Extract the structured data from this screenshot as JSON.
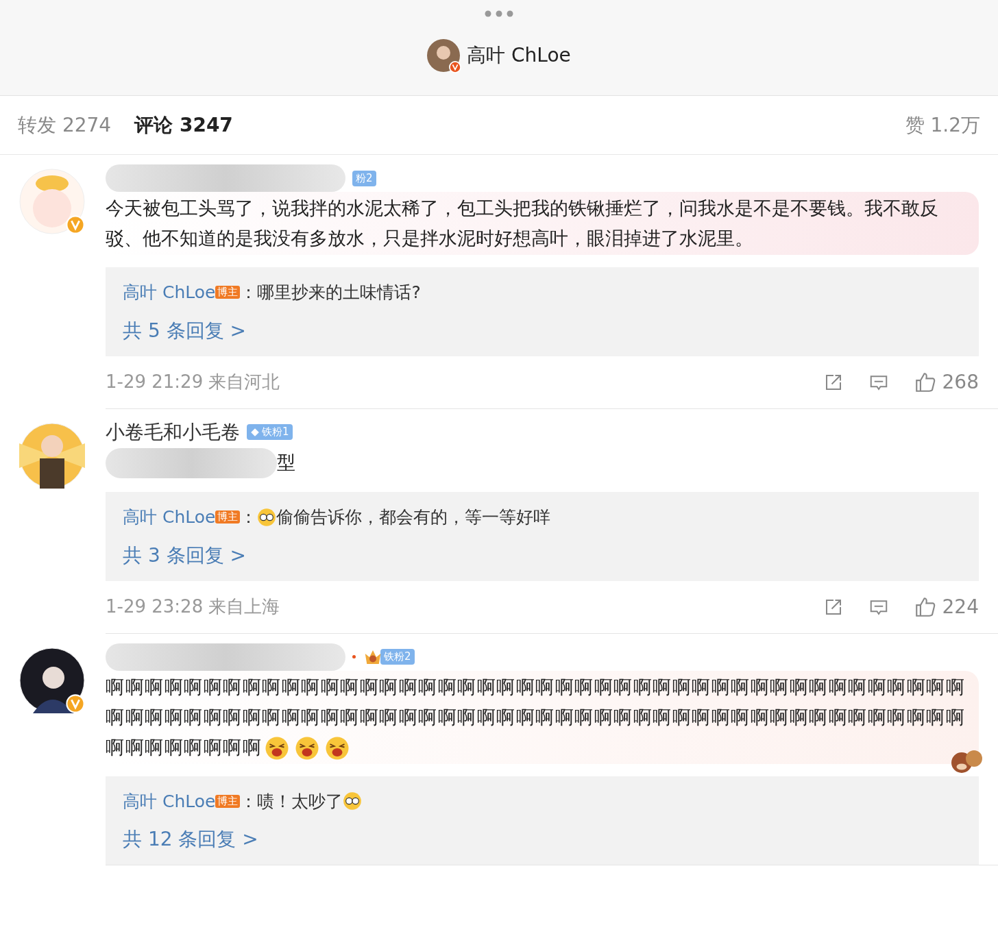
{
  "header": {
    "title": "高叶 ChLoe"
  },
  "tabs": [
    {
      "label": "转发",
      "count": "2274",
      "selected": false
    },
    {
      "label": "评论",
      "count": "3247",
      "selected": true
    }
  ],
  "likes_total": {
    "label": "赞",
    "count": "1.2万"
  },
  "comments": [
    {
      "verified": true,
      "badge": {
        "kind": "fan",
        "text": "粉2"
      },
      "color": "#fbe7ea",
      "sticker": false,
      "body": [
        {
          "kind": "text",
          "text": "今天被包工头骂了，说我拌的水泥太稀了，包工头把我的铁锹捶烂了，问我水是不是不要钱。我不敢反驳、他不知道的是我没有多放水，只是拌水泥时好想高叶，眼泪掉进了水泥里。"
        }
      ],
      "reply": {
        "author": "高叶 ChLoe",
        "badge": "博主",
        "parts": [
          {
            "kind": "text",
            "text": "：哪里抄来的土味情话?"
          }
        ],
        "more": "共 5 条回复 >"
      },
      "time": "1-29 21:29 来自河北",
      "likes": "268"
    },
    {
      "verified": false,
      "name": "小卷毛和小毛卷",
      "badge": {
        "kind": "diamond",
        "text": "铁粉1"
      },
      "sticker": false,
      "body": [
        {
          "kind": "blur"
        },
        {
          "kind": "text",
          "text": "型"
        }
      ],
      "reply": {
        "author": "高叶 ChLoe",
        "badge": "博主",
        "parts": [
          {
            "kind": "text",
            "text": "："
          },
          {
            "kind": "emoji"
          },
          {
            "kind": "text",
            "text": "偷偷告诉你，都会有的，等一等好咩"
          }
        ],
        "more": "共 3 条回复 >"
      },
      "time": "1-29 23:28 来自上海",
      "likes": "224"
    },
    {
      "verified": true,
      "badge": {
        "kind": "crown",
        "text": "铁粉2"
      },
      "color": "#fdf1ee",
      "sticker": true,
      "body": [
        {
          "kind": "text",
          "text": "啊啊啊啊啊啊啊啊啊啊啊啊啊啊啊啊啊啊啊啊啊啊啊啊啊啊啊啊啊啊啊啊啊啊啊啊啊啊啊啊啊啊啊啊啊啊啊啊啊啊啊啊啊啊啊啊啊啊啊啊啊啊啊啊啊啊啊啊啊啊啊啊啊啊啊啊啊啊啊啊啊啊啊啊啊啊啊啊啊啊啊啊啊啊啊啊"
        },
        {
          "kind": "laugh"
        },
        {
          "kind": "laugh"
        },
        {
          "kind": "laugh"
        }
      ],
      "reply": {
        "author": "高叶 ChLoe",
        "badge": "博主",
        "parts": [
          {
            "kind": "text",
            "text": "：啧！太吵了"
          },
          {
            "kind": "emoji"
          }
        ],
        "more": "共 12 条回复 >"
      }
    }
  ]
}
